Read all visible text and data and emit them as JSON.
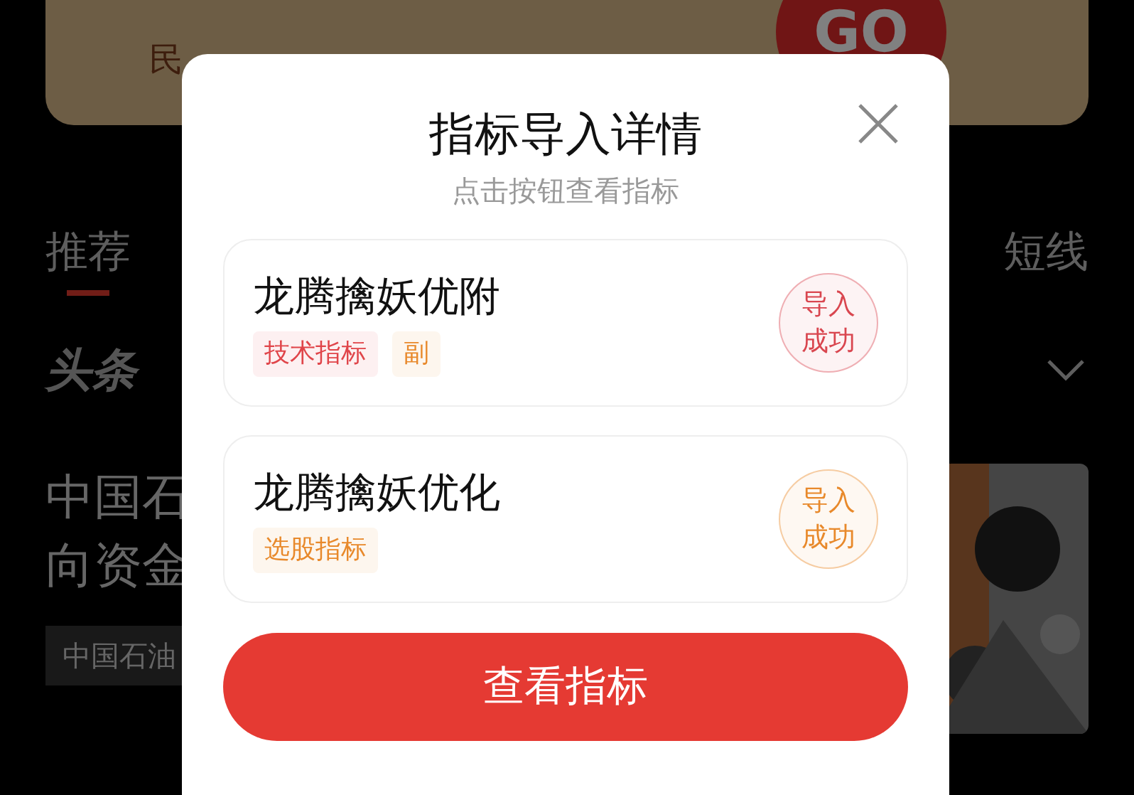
{
  "background": {
    "banner": {
      "subtitle": "民",
      "button": "GO"
    },
    "tabs": [
      {
        "label": "推荐",
        "selected": true
      },
      {
        "label": "短线",
        "selected": false
      }
    ],
    "section_logo": "头条",
    "article": {
      "title_lines": [
        "中国石",
        "向资金"
      ],
      "tag": "中国石油"
    }
  },
  "dialog": {
    "title": "指标导入详情",
    "subtitle": "点击按钮查看指标",
    "items": [
      {
        "name": "龙腾擒妖优附",
        "tags": [
          {
            "label": "技术指标",
            "color": "#e0454a"
          },
          {
            "label": "副",
            "color": "#e8892b"
          }
        ],
        "status": "导入成功",
        "color": "#d9464f"
      },
      {
        "name": "龙腾擒妖优化",
        "tags": [
          {
            "label": "选股指标",
            "color": "#e8892b"
          }
        ],
        "status": "导入成功",
        "color": "#e8892b"
      }
    ],
    "button": "查看指标"
  }
}
